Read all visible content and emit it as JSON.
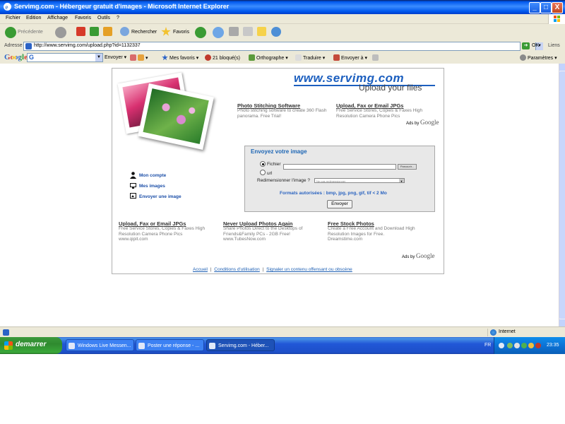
{
  "window": {
    "title": "Servimg.com - Hébergeur gratuit d'images - Microsoft Internet Explorer",
    "min_btn": "_",
    "max_btn": "□",
    "close_btn": "X"
  },
  "menubar": {
    "items": [
      "Fichier",
      "Edition",
      "Affichage",
      "Favoris",
      "Outils",
      "?"
    ]
  },
  "toolbar": {
    "back_label": "Précédente",
    "search_label": "Rechercher",
    "favorites_label": "Favoris"
  },
  "addressbar": {
    "label": "Adresse",
    "url": "http://www.servimg.com/upload.php?id=1132337",
    "go_label": "OK",
    "links_label": "Liens"
  },
  "googlebar": {
    "logo": "Google",
    "search_prefix": "G",
    "send_label": "Envoyer",
    "favorites_label": "Mes favoris",
    "blocked_label": "21 bloqué(s)",
    "spell_label": "Orthographe",
    "translate_label": "Traduire",
    "send_to_label": "Envoyer à",
    "settings_label": "Paramètres"
  },
  "page": {
    "logo_url": "www.servimg.com",
    "logo_tagline": "Upload your files",
    "top_ads": [
      {
        "title": "Photo Stitching Software",
        "text": "Photo stitching software to create 360 Flash panorama. Free Trial!"
      },
      {
        "title": "Upload, Fax or Email JPGs",
        "text": "Free Service Stores, Copies & Faxes High Resolution Camera Phone Pics"
      }
    ],
    "ads_by": "Ads by",
    "ads_by_brand": "Google",
    "side_links": [
      "Mon compte",
      "Mes images",
      "Envoyer une image"
    ],
    "upload": {
      "title": "Envoyez votre image",
      "file_label": "Fichier",
      "browse_label": "Parcourir...",
      "url_label": "url",
      "resize_label": "Redimensionner l'image ?",
      "resize_value": "Ne pas redimensionner",
      "formats": "Formats autorisées : bmp, jpg, png, gif, tif < 2 Mo",
      "send_button": "Envoyer"
    },
    "bottom_ads": [
      {
        "title": "Upload, Fax or Email JPGs",
        "text": "Free Service Stores, Copies & Faxes High Resolution Camera Phone Pics",
        "url": "www.qipit.com"
      },
      {
        "title": "Never Upload Photos Again",
        "text": "Share Photos Direct to the Desktops of Friends&Family PCs - 2GB Free!",
        "url": "www.TubesNow.com"
      },
      {
        "title": "Free Stock Photos",
        "text": "Create a Free Account and Download High Resolution Images for Free.",
        "url": "Dreamstime.com"
      }
    ],
    "footer": {
      "links": [
        "Accueil",
        "Conditions d'utilisation",
        "Signaler un contenu offensant ou obscène"
      ],
      "separator": "|"
    }
  },
  "statusbar": {
    "zone": "Internet"
  },
  "taskbar": {
    "start_label": "demarrer",
    "tasks": [
      "Windows Live Messen...",
      "Poster une réponse - ...",
      "Servimg.com - Héber..."
    ],
    "language": "FR",
    "clock": "23:35"
  },
  "colors": {
    "title_blue": "#0058ee",
    "link_blue": "#1c5fbf",
    "start_green": "#3c9a3c",
    "chrome": "#ece9d8"
  }
}
